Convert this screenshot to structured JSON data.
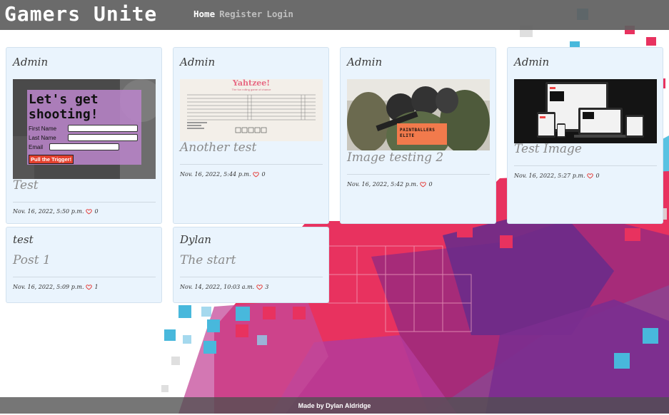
{
  "header": {
    "brand": "Gamers Unite",
    "nav": [
      {
        "label": "Home",
        "active": true
      },
      {
        "label": "Register",
        "active": false
      },
      {
        "label": "Login",
        "active": false
      }
    ]
  },
  "posts": [
    {
      "author": "Admin",
      "title": "Test",
      "date": "Nov. 16, 2022, 5:50 p.m.",
      "likes": "0",
      "image": {
        "kind": "signup-form",
        "heading": "Let's get shooting!",
        "fields": [
          "First Name",
          "Last Name",
          "Email"
        ],
        "button": "Pull the Trigger!"
      }
    },
    {
      "author": "Admin",
      "title": "Another test",
      "date": "Nov. 16, 2022, 5:44 p.m.",
      "likes": "0",
      "image": {
        "kind": "yahtzee-sheet",
        "heading": "Yahtzee!",
        "subheading": "The fun rolling game of chance"
      }
    },
    {
      "author": "Admin",
      "title": "Image testing 2",
      "date": "Nov. 16, 2022, 5:42 p.m.",
      "likes": "0",
      "image": {
        "kind": "paintball-photo",
        "caption": "PAINTBALLERS ELITE"
      }
    },
    {
      "author": "Admin",
      "title": "Test Image",
      "date": "Nov. 16, 2022, 5:27 p.m.",
      "likes": "0",
      "image": {
        "kind": "responsive-devices"
      }
    },
    {
      "author": "test",
      "title": "Post 1",
      "date": "Nov. 16, 2022, 5:09 p.m.",
      "likes": "1",
      "image": null
    },
    {
      "author": "Dylan",
      "title": "The start",
      "date": "Nov. 14, 2022, 10:03 a.m.",
      "likes": "3",
      "image": null
    }
  ],
  "footer": {
    "text": "Made by Dylan Aldridge"
  },
  "colors": {
    "header_bg": "#606060",
    "card_bg": "#eaf4fd",
    "heart": "#e53935",
    "footer_bg": "#505050"
  },
  "icons": {
    "like": "heart-outline-icon"
  }
}
